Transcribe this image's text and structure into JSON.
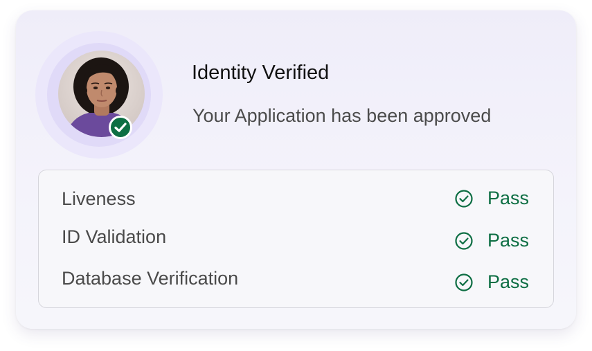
{
  "header": {
    "title": "Identity Verified",
    "subtitle": "Your Application has been approved"
  },
  "avatar": {
    "icon": "user-photo",
    "badge_icon": "check-icon",
    "badge_color": "#0d6e43"
  },
  "checks": [
    {
      "label": "Liveness",
      "status": "Pass",
      "icon": "check-circle-icon"
    },
    {
      "label": "ID Validation",
      "status": "Pass",
      "icon": "check-circle-icon"
    },
    {
      "label": "Database Verification",
      "status": "Pass",
      "icon": "check-circle-icon"
    }
  ],
  "colors": {
    "accent_green": "#0d6e43",
    "halo": "#e0daf8",
    "card_bg": "#f4f3fb"
  }
}
